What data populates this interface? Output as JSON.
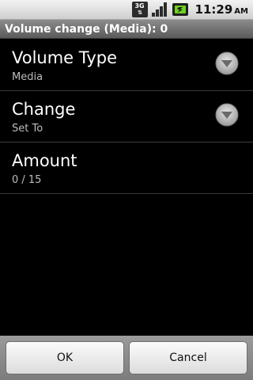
{
  "status_bar": {
    "network_type": "3G",
    "time": "11:29",
    "ampm": "AM"
  },
  "title_bar": {
    "title": "Volume change (Media): 0"
  },
  "preferences": [
    {
      "title": "Volume Type",
      "summary": "Media",
      "icon": "dropdown-arrow-icon"
    },
    {
      "title": "Change",
      "summary": "Set To",
      "icon": "dropdown-arrow-icon"
    },
    {
      "title": "Amount",
      "summary": "0 / 15"
    }
  ],
  "buttons": {
    "ok_label": "OK",
    "cancel_label": "Cancel"
  },
  "colors": {
    "background": "#000000",
    "title_bar": "#6e6e6e",
    "summary_text": "#bdbdbd"
  }
}
